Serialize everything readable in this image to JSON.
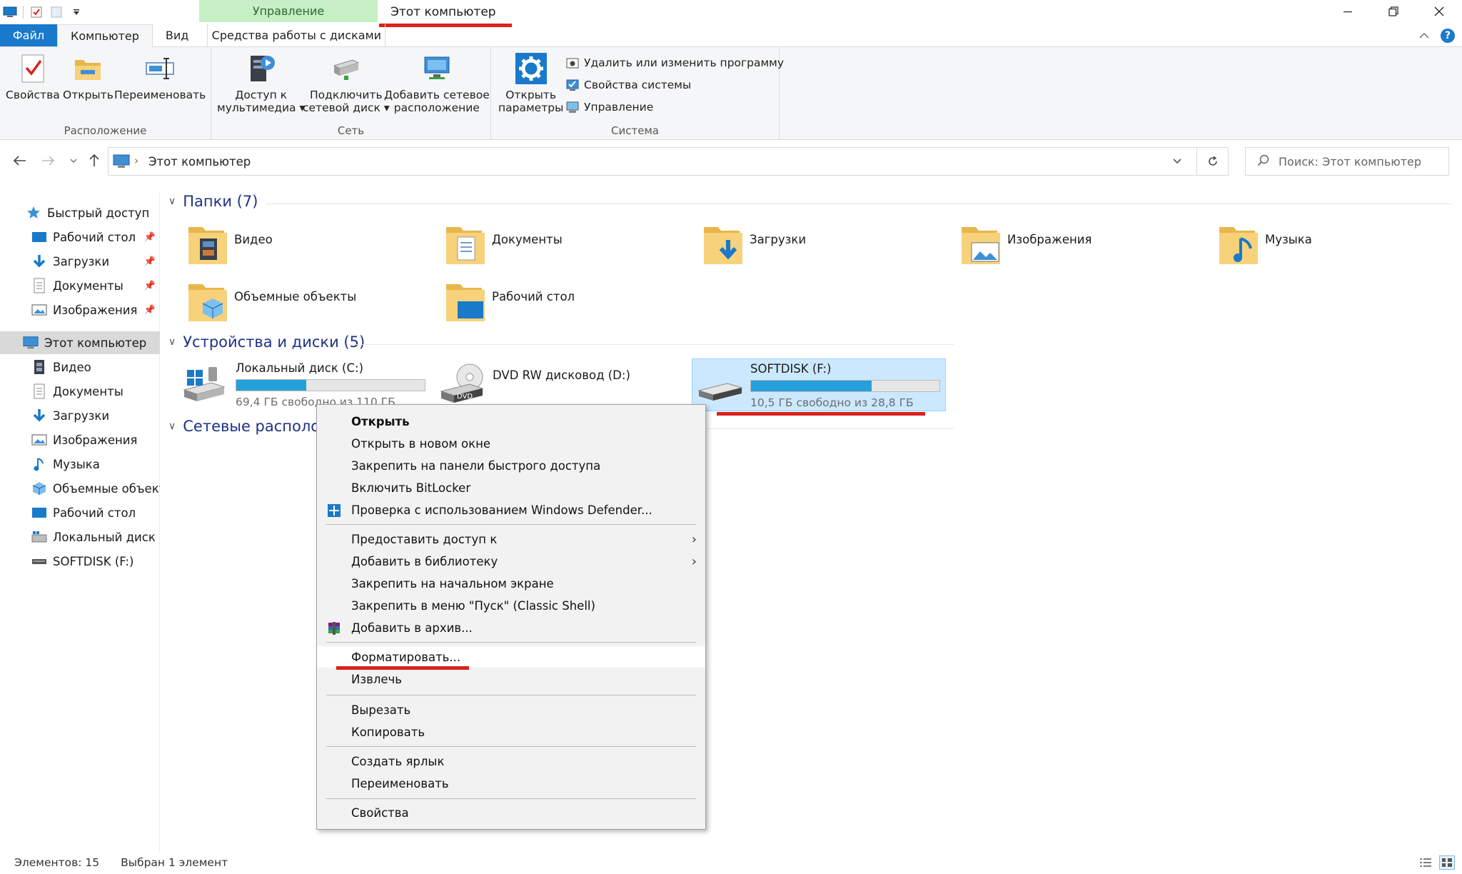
{
  "window": {
    "title": "Этот компьютер",
    "context_tab_group": "Управление",
    "accent": "#1979ca",
    "annotation_color": "#d9231b"
  },
  "tabs": {
    "file": "Файл",
    "computer": "Компьютер",
    "view": "Вид",
    "disk_tools": "Средства работы с дисками"
  },
  "ribbon": {
    "location": {
      "label": "Расположение",
      "properties": "Свойства",
      "open": "Открыть",
      "rename": "Переименовать"
    },
    "network": {
      "label": "Сеть",
      "media_line1": "Доступ к",
      "media_line2": "мультимедиа",
      "map_drive_line1": "Подключить",
      "map_drive_line2": "сетевой диск",
      "add_location_line1": "Добавить сетевое",
      "add_location_line2": "расположение"
    },
    "system": {
      "label": "Система",
      "open_settings_line1": "Открыть",
      "open_settings_line2": "параметры",
      "uninstall": "Удалить или изменить программу",
      "system_properties": "Свойства системы",
      "manage": "Управление"
    }
  },
  "address": {
    "path": "Этот компьютер",
    "search_placeholder": "Поиск: Этот компьютер"
  },
  "sidebar": {
    "items": [
      {
        "label": "Быстрый доступ",
        "icon": "star-icon"
      },
      {
        "label": "Рабочий стол",
        "icon": "desktop-icon",
        "pinned": true
      },
      {
        "label": "Загрузки",
        "icon": "download-icon",
        "pinned": true
      },
      {
        "label": "Документы",
        "icon": "document-icon",
        "pinned": true
      },
      {
        "label": "Изображения",
        "icon": "image-icon",
        "pinned": true
      },
      {
        "label": "Этот компьютер",
        "icon": "computer-icon",
        "selected": true
      },
      {
        "label": "Видео",
        "icon": "video-icon"
      },
      {
        "label": "Документы",
        "icon": "document-icon"
      },
      {
        "label": "Загрузки",
        "icon": "download-icon"
      },
      {
        "label": "Изображения",
        "icon": "image-icon"
      },
      {
        "label": "Музыка",
        "icon": "music-icon"
      },
      {
        "label": "Объемные объекты",
        "icon": "3d-objects-icon"
      },
      {
        "label": "Рабочий стол",
        "icon": "desktop-icon"
      },
      {
        "label": "Локальный диск (C:)",
        "icon": "local-disk-icon"
      },
      {
        "label": "SOFTDISK (F:)",
        "icon": "usb-drive-icon"
      }
    ]
  },
  "content": {
    "folders_header": "Папки (7)",
    "folders": [
      {
        "name": "Видео",
        "icon": "video-folder-icon"
      },
      {
        "name": "Документы",
        "icon": "documents-folder-icon"
      },
      {
        "name": "Загрузки",
        "icon": "downloads-folder-icon"
      },
      {
        "name": "Изображения",
        "icon": "pictures-folder-icon"
      },
      {
        "name": "Музыка",
        "icon": "music-folder-icon"
      },
      {
        "name": "Объемные объекты",
        "icon": "3d-objects-folder-icon"
      },
      {
        "name": "Рабочий стол",
        "icon": "desktop-folder-icon"
      }
    ],
    "devices_header": "Устройства и диски (5)",
    "drives": [
      {
        "name": "Локальный диск (C:)",
        "free": "69,4 ГБ свободно из 110 ГБ",
        "used_fraction": 0.37
      },
      {
        "name": "DVD RW дисковод (D:)"
      },
      {
        "name": "SOFTDISK (F:)",
        "free": "10,5 ГБ свободно из 28,8 ГБ",
        "used_fraction": 0.64,
        "selected": true
      }
    ],
    "network_header": "Сетевые располож"
  },
  "context_menu": {
    "open": "Открыть",
    "open_new_window": "Открыть в новом окне",
    "pin_quick_access": "Закрепить на панели быстрого доступа",
    "bitlocker": "Включить BitLocker",
    "defender": "Проверка с использованием Windows Defender...",
    "give_access": "Предоставить доступ к",
    "add_library": "Добавить в библиотеку",
    "pin_start": "Закрепить на начальном экране",
    "pin_classic": "Закрепить в меню \"Пуск\" (Classic Shell)",
    "add_archive": "Добавить в архив...",
    "format": "Форматировать...",
    "eject": "Извлечь",
    "cut": "Вырезать",
    "copy": "Копировать",
    "shortcut": "Создать ярлык",
    "rename": "Переименовать",
    "properties": "Свойства"
  },
  "status": {
    "items_count": "Элементов: 15",
    "selected": "Выбран 1 элемент"
  }
}
